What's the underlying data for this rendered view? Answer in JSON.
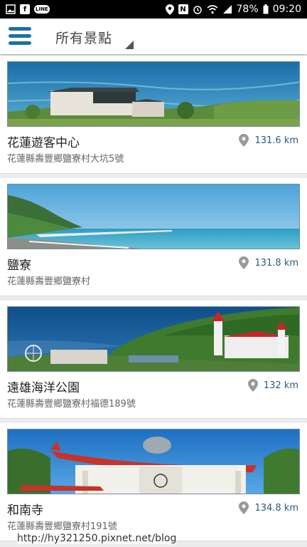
{
  "status_bar": {
    "left_icons": [
      "image-icon",
      "facebook-icon",
      "line-icon"
    ],
    "right_icons": [
      "location-icon",
      "nfc-icon",
      "alarm-icon",
      "wifi-icon",
      "signal-icon"
    ],
    "battery": "78%",
    "time": "09:20"
  },
  "app_bar": {
    "menu_icon": "hamburger-menu-icon",
    "filter_label": "所有景點",
    "accent_color": "#1f6fa8"
  },
  "places": [
    {
      "name": "花蓮遊客中心",
      "address": "花蓮縣壽豐鄉鹽寮村大坑5號",
      "distance": "131.6 km",
      "image": "coastal-visitor-center-photo"
    },
    {
      "name": "鹽寮",
      "address": "花蓮縣壽豐鄉鹽寮村",
      "distance": "131.8 km",
      "image": "coastline-beach-photo"
    },
    {
      "name": "遠雄海洋公園",
      "address": "花蓮縣壽豐鄉鹽寮村福德189號",
      "distance": "132 km",
      "image": "ocean-park-castle-photo"
    },
    {
      "name": "和南寺",
      "address": "花蓮縣壽豐鄉鹽寮村191號",
      "distance": "134.8 km",
      "image": "temple-roof-photo"
    }
  ],
  "watermark": "http://hy321250.pixnet.net/blog"
}
